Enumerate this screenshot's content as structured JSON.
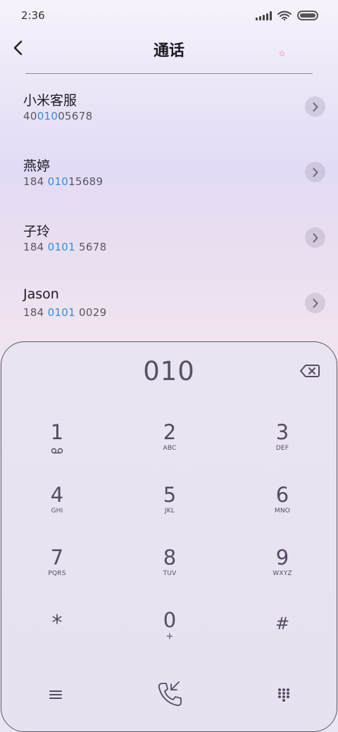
{
  "status_bar": {
    "time": "2:36",
    "icons": [
      "signal-icon",
      "wifi-icon",
      "battery-icon"
    ]
  },
  "header": {
    "title": "通话",
    "back_icon": "chevron-left-icon"
  },
  "contacts": [
    {
      "name": "小米客服",
      "number_pre": "40",
      "number_match": "010",
      "number_post": "05678"
    },
    {
      "name": "燕婷",
      "number_pre": "184 ",
      "number_match": "010",
      "number_post": "15689"
    },
    {
      "name": "子玲",
      "number_pre": "184 ",
      "number_match": "0101",
      "number_post": " 5678"
    },
    {
      "name": "Jason",
      "number_pre": "184 ",
      "number_match": "0101",
      "number_post": " 0029"
    }
  ],
  "dialer": {
    "dialed": "010",
    "keys": [
      {
        "digit": "1",
        "letters": ""
      },
      {
        "digit": "2",
        "letters": "ABC"
      },
      {
        "digit": "3",
        "letters": "DEF"
      },
      {
        "digit": "4",
        "letters": "GHI"
      },
      {
        "digit": "5",
        "letters": "JKL"
      },
      {
        "digit": "6",
        "letters": "MNO"
      },
      {
        "digit": "7",
        "letters": "PQRS"
      },
      {
        "digit": "8",
        "letters": "TUV"
      },
      {
        "digit": "9",
        "letters": "WXYZ"
      },
      {
        "digit": "*",
        "letters": ""
      },
      {
        "digit": "0",
        "letters": "+"
      },
      {
        "digit": "#",
        "letters": ""
      }
    ]
  },
  "colors": {
    "highlight": "#2f8fd6",
    "key_text": "#564a62"
  }
}
